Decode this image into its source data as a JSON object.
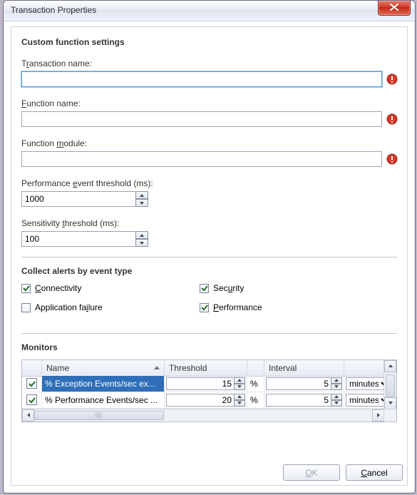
{
  "window": {
    "title": "Transaction Properties"
  },
  "sections": {
    "custom": {
      "heading": "Custom function settings",
      "transaction_name": {
        "label_pre": "T",
        "label_ul": "r",
        "label_post": "ansaction name:",
        "value": ""
      },
      "function_name": {
        "label_pre": "",
        "label_ul": "F",
        "label_post": "unction name:",
        "value": ""
      },
      "function_module": {
        "label_pre": "Function ",
        "label_ul": "m",
        "label_post": "odule:",
        "value": ""
      },
      "perf_threshold": {
        "label_pre": "Performance ",
        "label_ul": "e",
        "label_post": "vent threshold (ms):",
        "value": "1000"
      },
      "sensitivity": {
        "label_pre": "Sensitivity ",
        "label_ul": "t",
        "label_post": "hreshold (ms):",
        "value": "100"
      }
    },
    "alerts": {
      "heading": "Collect alerts by event type",
      "connectivity": {
        "label_pre": "",
        "label_ul": "C",
        "label_post": "onnectivity",
        "checked": true
      },
      "security": {
        "label_pre": "Sec",
        "label_ul": "u",
        "label_post": "rity",
        "checked": true
      },
      "app_failure": {
        "label_pre": "Application fa",
        "label_ul": "i",
        "label_post": "lure",
        "checked": false
      },
      "performance": {
        "label_pre": "",
        "label_ul": "P",
        "label_post": "erformance",
        "checked": true
      }
    },
    "monitors": {
      "heading": "Monitors",
      "columns": {
        "col1": "",
        "col2": "Name",
        "col3": "Threshold",
        "col4": "",
        "col5": "Interval",
        "col6": ""
      },
      "rows": [
        {
          "enabled": true,
          "name": "% Exception Events/sec ex...",
          "threshold": "15",
          "threshold_unit": "%",
          "interval": "5",
          "interval_unit": "minutes",
          "selected": true
        },
        {
          "enabled": true,
          "name": "% Performance Events/sec ...",
          "threshold": "20",
          "threshold_unit": "%",
          "interval": "5",
          "interval_unit": "minutes",
          "selected": false
        }
      ],
      "unit_options": [
        "minutes"
      ]
    }
  },
  "buttons": {
    "ok": {
      "pre": "",
      "ul": "O",
      "post": "K",
      "enabled": false
    },
    "cancel": {
      "pre": "",
      "ul": "C",
      "post": "ancel",
      "enabled": true
    }
  }
}
